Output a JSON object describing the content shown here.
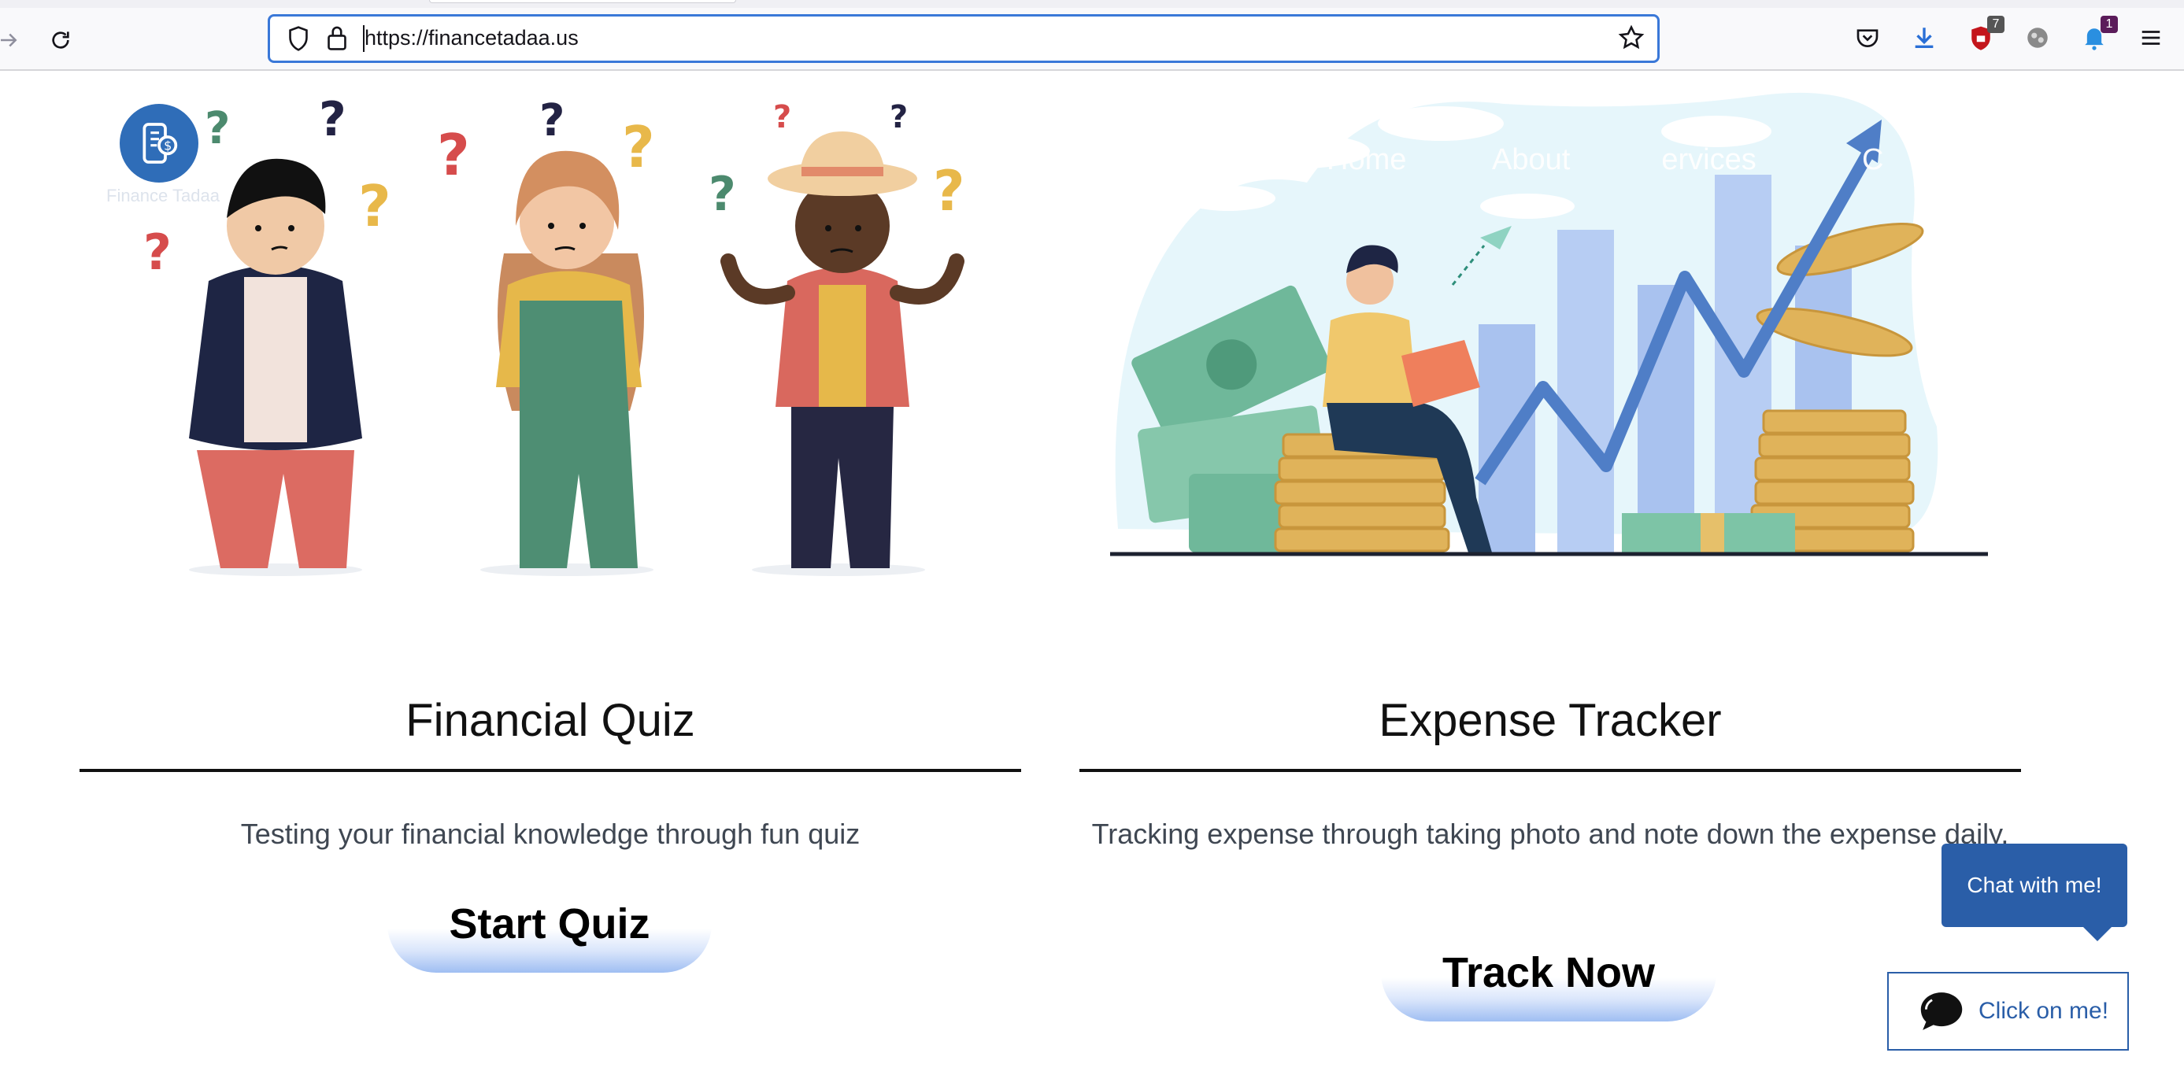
{
  "browser": {
    "url": "https://financetadaa.us",
    "extensions": {
      "shield_badge": "7",
      "notif_badge": "1"
    }
  },
  "site": {
    "logo_text": "Finance Tadaa",
    "nav": [
      {
        "label": "Home"
      },
      {
        "label": "About"
      },
      {
        "label": "Services"
      },
      {
        "label": "C"
      }
    ]
  },
  "cards": {
    "quiz": {
      "title": "Financial Quiz",
      "description": "Testing your financial knowledge through fun quiz",
      "button": "Start Quiz"
    },
    "tracker": {
      "title": "Expense Tracker",
      "description": "Tracking expense through taking photo and note down the expense daily.",
      "button": "Track Now"
    }
  },
  "chat": {
    "bubble": "Chat with me!",
    "button": "Click on me!"
  },
  "colors": {
    "accent": "#2a5ea8",
    "url_focus": "#3a78d8"
  },
  "icons": [
    "forward-icon",
    "reload-icon",
    "shield-icon",
    "lock-icon",
    "star-icon",
    "pocket-icon",
    "download-icon",
    "ublock-icon",
    "extension-icon",
    "notification-icon",
    "menu-icon",
    "chat-icon"
  ]
}
